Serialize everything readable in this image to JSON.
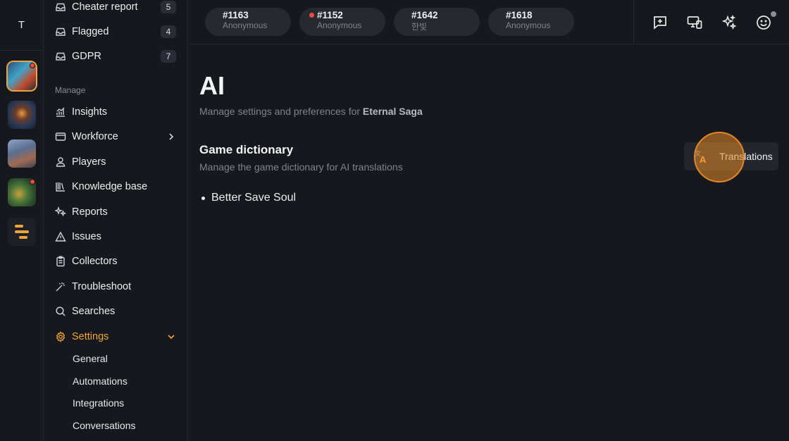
{
  "rail": {
    "user_initial": "T",
    "apps": [
      {
        "name": "game-1",
        "active": true,
        "notify": true
      },
      {
        "name": "game-2",
        "active": false,
        "notify": false
      },
      {
        "name": "game-3",
        "active": false,
        "notify": false
      },
      {
        "name": "game-4",
        "active": false,
        "notify": true
      },
      {
        "name": "game-5",
        "active": false,
        "notify": false
      }
    ]
  },
  "sidebar": {
    "inbox_items": [
      {
        "label": "Cheater report",
        "count": "5"
      },
      {
        "label": "Flagged",
        "count": "4"
      },
      {
        "label": "GDPR",
        "count": "7"
      }
    ],
    "manage_label": "Manage",
    "manage_items": [
      {
        "label": "Insights",
        "icon": "insights-icon"
      },
      {
        "label": "Workforce",
        "icon": "workforce-icon"
      },
      {
        "label": "Players",
        "icon": "players-icon"
      },
      {
        "label": "Knowledge base",
        "icon": "knowledge-base-icon"
      },
      {
        "label": "Reports",
        "icon": "reports-icon"
      },
      {
        "label": "Issues",
        "icon": "issues-icon"
      },
      {
        "label": "Collectors",
        "icon": "collectors-icon"
      },
      {
        "label": "Troubleshoot",
        "icon": "troubleshoot-icon"
      },
      {
        "label": "Searches",
        "icon": "search-icon"
      },
      {
        "label": "Settings",
        "icon": "gear-icon"
      }
    ],
    "settings_sub": [
      "General",
      "Automations",
      "Integrations",
      "Conversations"
    ]
  },
  "topbar": {
    "tickets": [
      {
        "number": "#1163",
        "who": "Anonymous",
        "unread": false
      },
      {
        "number": "#1152",
        "who": "Anonymous",
        "unread": true
      },
      {
        "number": "#1642",
        "who": "한빛",
        "unread": false
      },
      {
        "number": "#1618",
        "who": "Anonymous",
        "unread": false
      }
    ]
  },
  "main": {
    "title": "AI",
    "subtitle_prefix": "Manage settings and preferences for",
    "game_name": "Eternal Saga",
    "section_title": "Game dictionary",
    "section_subtitle": "Manage the game dictionary for AI translations",
    "dictionary": [
      "Better Save Soul"
    ],
    "translations_button": "Translations"
  },
  "colors": {
    "accent": "#f0a53a",
    "notify": "#ef4b3c",
    "background": "#16181d"
  }
}
